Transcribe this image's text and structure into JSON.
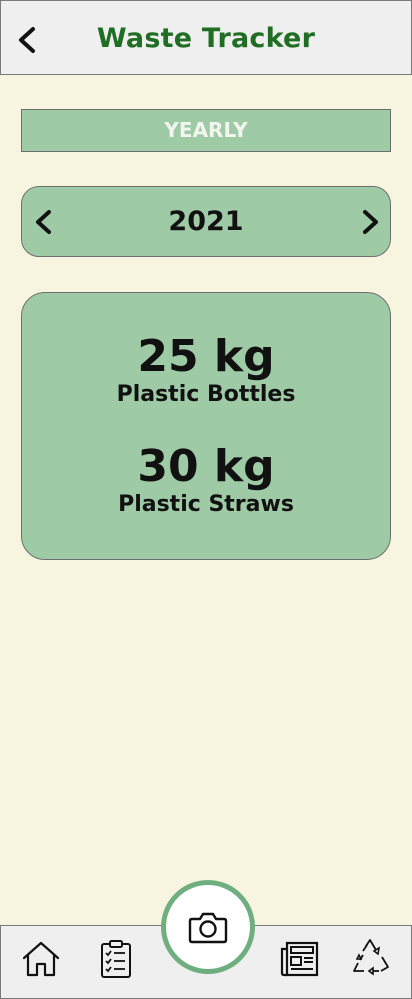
{
  "header": {
    "title": "Waste Tracker",
    "back_icon": "chevron-left-icon"
  },
  "period": {
    "label": "YEARLY"
  },
  "year_selector": {
    "year": "2021",
    "prev_icon": "chevron-left-icon",
    "next_icon": "chevron-right-icon"
  },
  "stats": [
    {
      "amount": "25 kg",
      "label": "Plastic Bottles"
    },
    {
      "amount": "30 kg",
      "label": "Plastic Straws"
    }
  ],
  "bottom_nav": {
    "items": [
      {
        "icon": "home-icon"
      },
      {
        "icon": "clipboard-checklist-icon"
      },
      {
        "icon": "camera-icon"
      },
      {
        "icon": "newspaper-icon"
      },
      {
        "icon": "recycle-icon"
      }
    ]
  },
  "colors": {
    "background": "#f7f4df",
    "header_bg": "#efefef",
    "title_green": "#1f6e24",
    "card_green": "#9ecba6",
    "camera_ring": "#6fae7f"
  }
}
